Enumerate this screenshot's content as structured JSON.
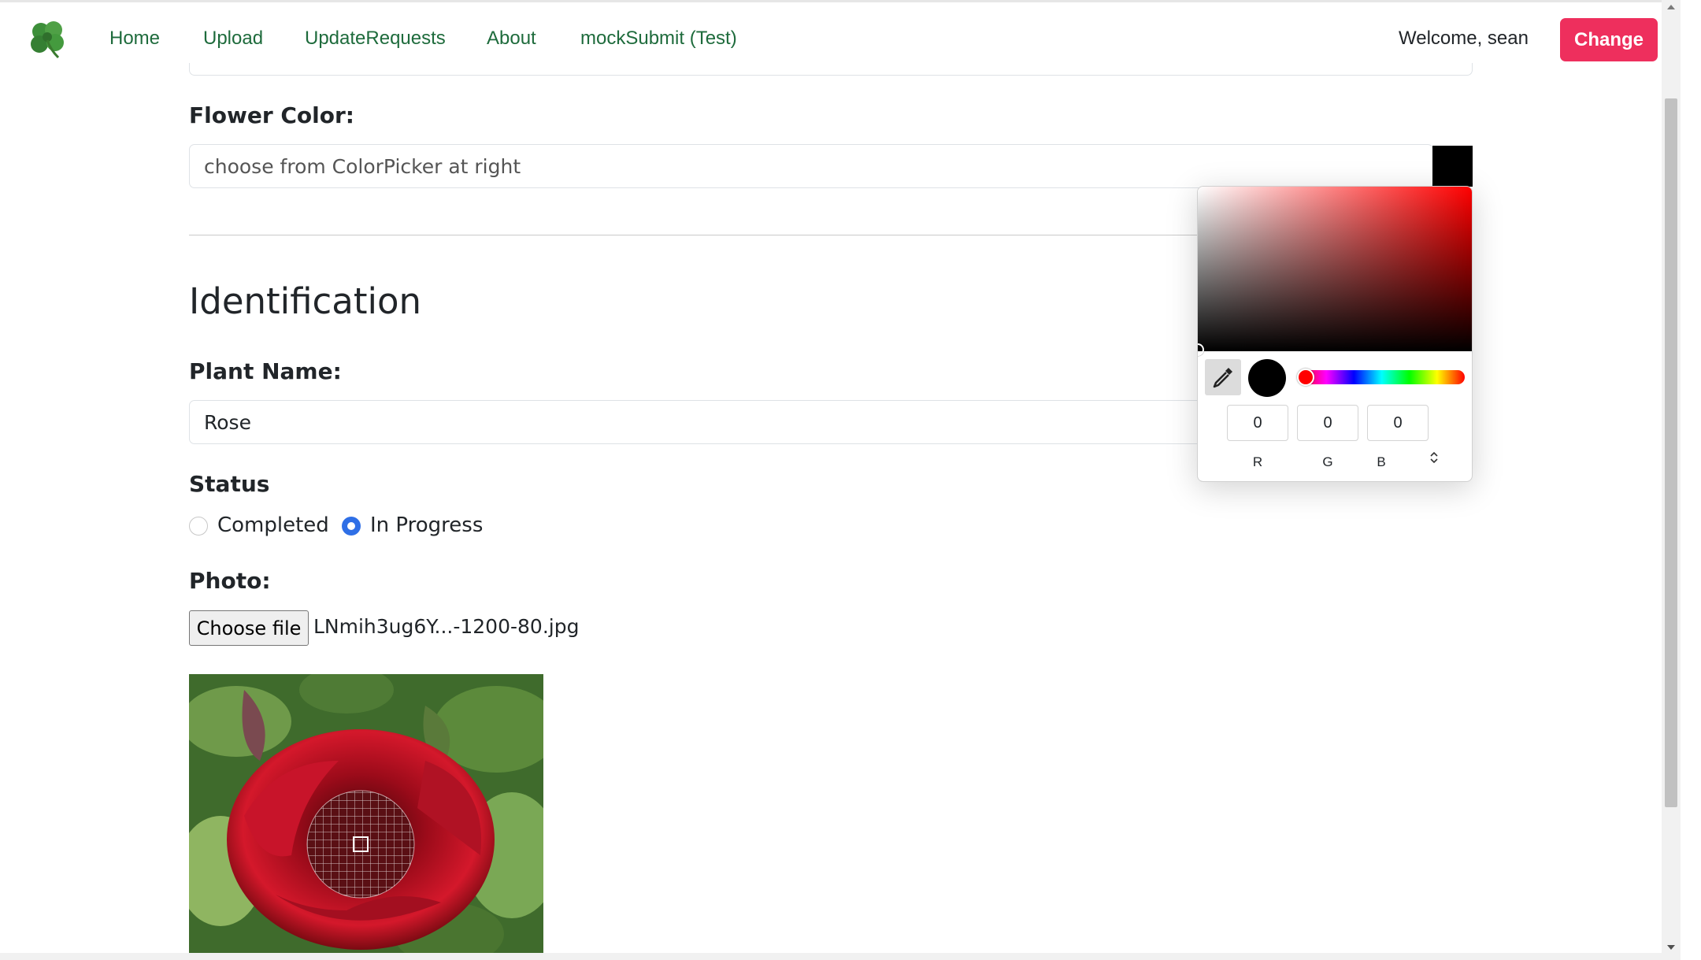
{
  "navbar": {
    "links": [
      "Home",
      "Upload",
      "UpdateRequests",
      "About",
      "mockSubmit (Test)"
    ],
    "welcome": "Welcome, sean",
    "change_button": "Change"
  },
  "form": {
    "flower_color": {
      "label": "Flower Color:",
      "placeholder": "choose from ColorPicker at right",
      "swatch_color": "#000000"
    },
    "identification_heading": "Identification",
    "plant_name": {
      "label": "Plant Name:",
      "value": "Rose"
    },
    "status": {
      "label": "Status",
      "options": [
        {
          "label": "Completed",
          "checked": false
        },
        {
          "label": "In Progress",
          "checked": true
        }
      ]
    },
    "photo": {
      "label": "Photo:",
      "choose_button": "Choose file",
      "file_name": "LNmih3ug6Y...-1200-80.jpg"
    }
  },
  "color_picker": {
    "hue_color": "#ff0000",
    "r": {
      "label": "R",
      "value": "0"
    },
    "g": {
      "label": "G",
      "value": "0"
    },
    "b": {
      "label": "B",
      "value": "0"
    }
  },
  "colors": {
    "nav_link": "#1e6b3c",
    "accent_button": "#ee2f5d",
    "radio_checked": "#2f6fe6"
  }
}
